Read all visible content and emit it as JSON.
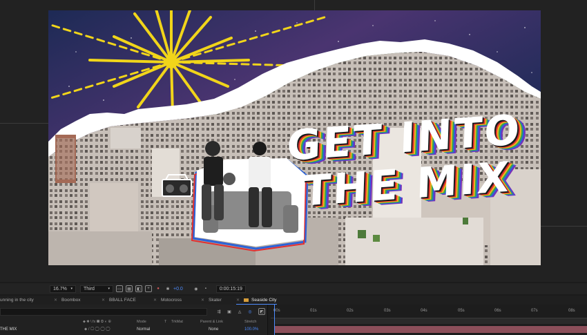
{
  "composition": {
    "headline_line1": "GET INTO",
    "headline_line2": "THE MIX"
  },
  "viewer_toolbar": {
    "zoom": "16.7%",
    "resolution": "Third",
    "exposure": "+0.0",
    "timecode": "0:00:15:19",
    "icons": [
      "magnification-dropdown-icon",
      "resolution-dropdown-icon",
      "region-of-interest-icon",
      "transparency-grid-icon",
      "mask-visibility-icon",
      "guides-icon",
      "color-channel-icon",
      "reset-exposure-icon",
      "snapshot-icon",
      "show-snapshot-icon"
    ]
  },
  "tabs": [
    {
      "label": "unning in the city",
      "active": false
    },
    {
      "label": "Boombox",
      "active": false
    },
    {
      "label": "BBALL FACE",
      "active": false
    },
    {
      "label": "Motocross",
      "active": false
    },
    {
      "label": "Skater",
      "active": false
    },
    {
      "label": "Seaside City",
      "active": true
    }
  ],
  "timeline": {
    "ruler": [
      "00s",
      "01s",
      "02s",
      "03s",
      "04s",
      "05s",
      "06s",
      "07s",
      "08s"
    ],
    "columns": {
      "mode": "Mode",
      "t": "T",
      "trkmat": "TrkMat",
      "parent": "Parent & Link",
      "stretch": "Stretch"
    },
    "layer": {
      "name": "THE MIX",
      "mode": "Normal",
      "parent": "None",
      "stretch": "100.0%"
    },
    "accent_color": "#4d8cff",
    "layer_bar_color": "#8c4f5a"
  }
}
